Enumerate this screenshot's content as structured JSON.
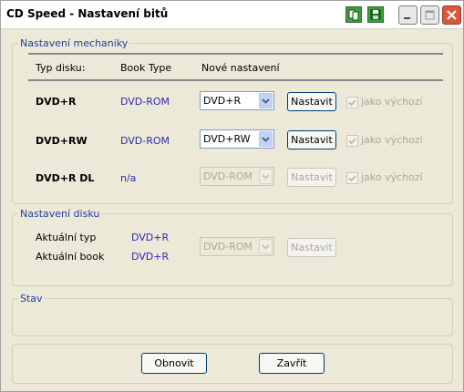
{
  "window": {
    "title": "CD Speed - Nastavení bitů",
    "icons": [
      "copy-icon",
      "save-icon"
    ],
    "controls": [
      "minimize-icon",
      "maximize-icon",
      "close-icon"
    ]
  },
  "drive_settings": {
    "group_title": "Nastavení mechaniky",
    "headers": {
      "disc_type": "Typ disku:",
      "book_type": "Book Type",
      "new_setting": "Nové nastavení"
    },
    "rows": [
      {
        "disc": "DVD+R",
        "book": "DVD-ROM",
        "select_value": "DVD+R",
        "select_enabled": true,
        "button": "Nastavit",
        "button_enabled": true,
        "checkbox_label": "jako výchozí",
        "checked": true,
        "checkbox_enabled": false
      },
      {
        "disc": "DVD+RW",
        "book": "DVD-ROM",
        "select_value": "DVD+RW",
        "select_enabled": true,
        "button": "Nastavit",
        "button_enabled": true,
        "checkbox_label": "jako výchozí",
        "checked": true,
        "checkbox_enabled": false
      },
      {
        "disc": "DVD+R DL",
        "book": "n/a",
        "select_value": "DVD-ROM",
        "select_enabled": false,
        "button": "Nastavit",
        "button_enabled": false,
        "checkbox_label": "jako výchozí",
        "checked": true,
        "checkbox_enabled": false
      }
    ]
  },
  "disc_settings": {
    "group_title": "Nastavení disku",
    "current_type_label": "Aktuální typ",
    "current_type_value": "DVD+R",
    "current_book_label": "Aktuální book",
    "current_book_value": "DVD+R",
    "select_value": "DVD-ROM",
    "button": "Nastavit"
  },
  "status": {
    "group_title": "Stav",
    "text": ""
  },
  "footer": {
    "refresh_button": "Obnovit",
    "close_button": "Zavřít"
  },
  "colors": {
    "group_title": "#1f3fa0",
    "book_value": "#2b2bb0",
    "disabled": "#aca899",
    "title_icon": "#3aa13a",
    "close_button": "#d9573c"
  }
}
